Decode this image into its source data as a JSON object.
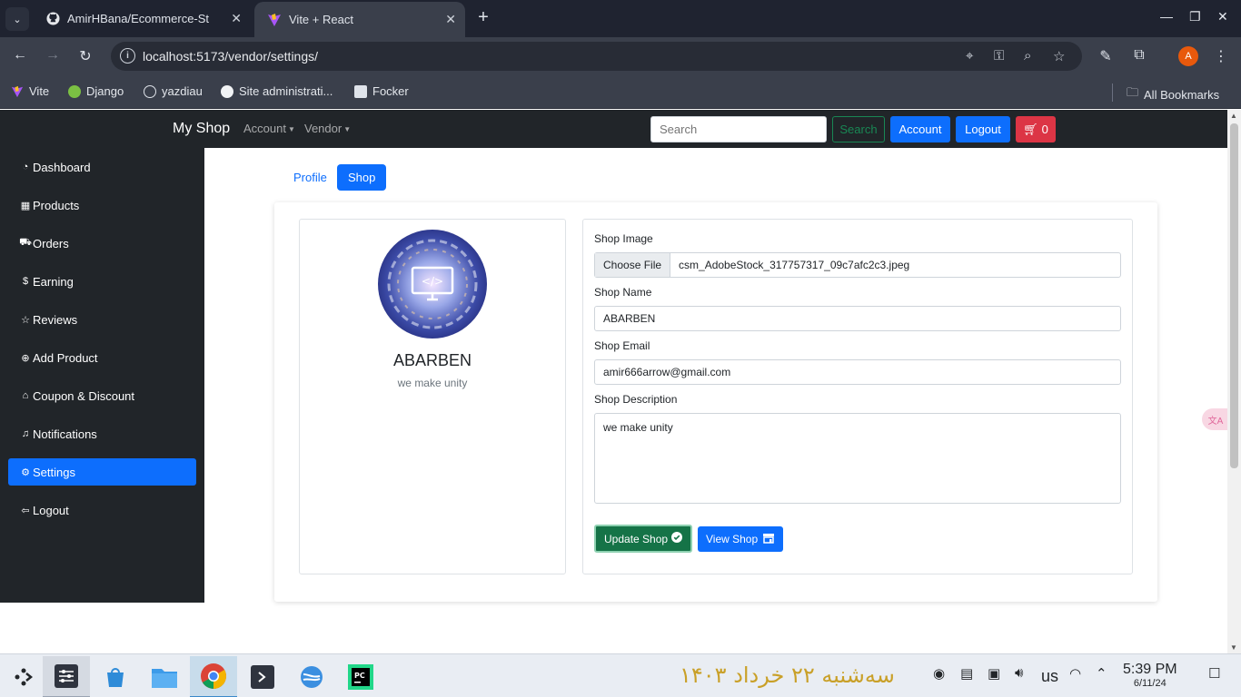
{
  "browser": {
    "tabs": [
      {
        "title": "AmirHBana/Ecommerce-St",
        "active": false
      },
      {
        "title": "Vite + React",
        "active": true
      }
    ],
    "url": "localhost:5173/vendor/settings/",
    "bookmarks": [
      "Vite",
      "Django",
      "yazdiau",
      "Site administrati...",
      "Focker"
    ],
    "all_bookmarks": "All Bookmarks",
    "profile_initial": "A"
  },
  "navbar": {
    "brand": "My Shop",
    "account_dd": "Account",
    "vendor_dd": "Vendor",
    "search_placeholder": "Search",
    "search_btn": "Search",
    "account_btn": "Account",
    "logout_btn": "Logout",
    "cart_count": "0"
  },
  "sidebar": {
    "items": [
      {
        "label": "Dashboard",
        "icon": "gauge-icon"
      },
      {
        "label": "Products",
        "icon": "grid-icon"
      },
      {
        "label": "Orders",
        "icon": "cart-icon"
      },
      {
        "label": "Earning",
        "icon": "dollar-icon"
      },
      {
        "label": "Reviews",
        "icon": "star-icon"
      },
      {
        "label": "Add Product",
        "icon": "plus-circle-icon"
      },
      {
        "label": "Coupon & Discount",
        "icon": "tag-icon"
      },
      {
        "label": "Notifications",
        "icon": "bell-icon"
      },
      {
        "label": "Settings",
        "icon": "gear-icon",
        "active": true
      },
      {
        "label": "Logout",
        "icon": "logout-icon"
      }
    ]
  },
  "tabs": {
    "profile": "Profile",
    "shop": "Shop"
  },
  "shop_card": {
    "name": "ABARBEN",
    "description": "we make unity"
  },
  "form": {
    "image_label": "Shop Image",
    "choose_file": "Choose File",
    "file_name": "csm_AdobeStock_317757317_09c7afc2c3.jpeg",
    "name_label": "Shop Name",
    "name_value": "ABARBEN",
    "email_label": "Shop Email",
    "email_value": "amir666arrow@gmail.com",
    "desc_label": "Shop Description",
    "desc_value": "we make unity",
    "update_btn": "Update Shop",
    "view_btn": "View Shop"
  },
  "taskbar": {
    "persian_date": "سه‌شنبه ۲۲ خرداد ۱۴۰۳",
    "keyboard": "us",
    "time": "5:39 PM",
    "date": "6/11/24"
  },
  "colors": {
    "primary": "#0d6efd",
    "dark": "#212529",
    "success": "#157347",
    "danger": "#dc3545"
  }
}
